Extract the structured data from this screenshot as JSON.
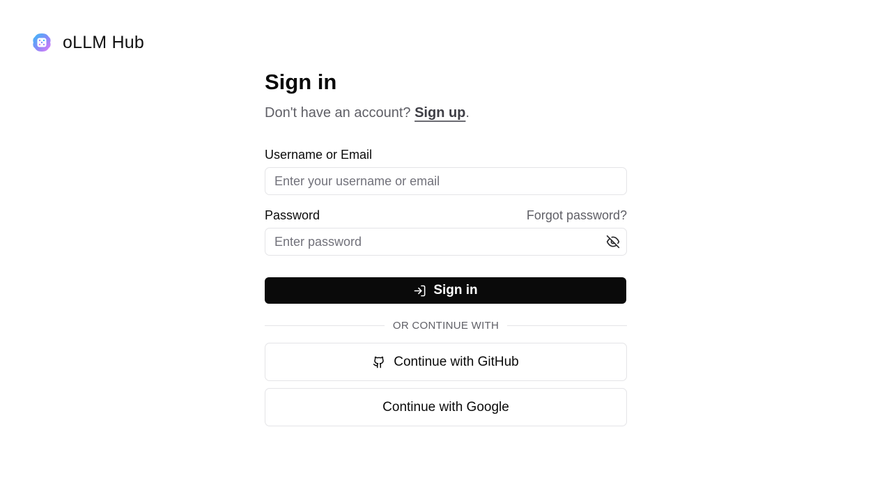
{
  "brand": {
    "name": "oLLM Hub",
    "logo_icon": "ollm-hub-logo-icon"
  },
  "signin": {
    "title": "Sign in",
    "subtitle_prefix": "Don't have an account? ",
    "signup_link": "Sign up",
    "subtitle_suffix": "."
  },
  "username": {
    "label": "Username or Email",
    "placeholder": "Enter your username or email",
    "value": ""
  },
  "password": {
    "label": "Password",
    "forgot_link": "Forgot password?",
    "placeholder": "Enter password",
    "value": "",
    "toggle_icon": "eye-off-icon"
  },
  "submit": {
    "label": "Sign in",
    "icon": "log-in-icon"
  },
  "divider": {
    "text": "OR CONTINUE WITH"
  },
  "social": {
    "github": {
      "label": "Continue with GitHub",
      "icon": "github-icon"
    },
    "google": {
      "label": "Continue with Google"
    }
  }
}
